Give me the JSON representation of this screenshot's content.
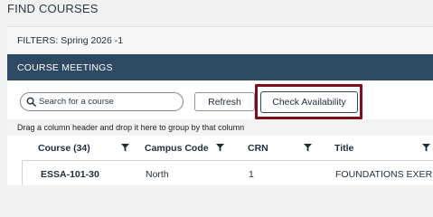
{
  "page": {
    "title": "FIND COURSES"
  },
  "filters": {
    "text": "FILTERS: Spring 2026 -1"
  },
  "section": {
    "title": "COURSE MEETINGS"
  },
  "toolbar": {
    "search_placeholder": "Search for a course",
    "refresh_label": "Refresh",
    "check_availability_label": "Check Availability"
  },
  "grid": {
    "group_hint": "Drag a column header and drop it here to group by that column",
    "columns": [
      {
        "label": "Course (34)",
        "icon": "filter-icon"
      },
      {
        "label": "Campus Code",
        "icon": "filter-icon"
      },
      {
        "label": "CRN",
        "icon": "filter-icon"
      },
      {
        "label": "Title",
        "icon": "filter-icon"
      }
    ],
    "rows": [
      {
        "course": "ESSA-101-30",
        "campus": "North",
        "crn": "1",
        "title": "FOUNDATIONS EXER..."
      }
    ]
  },
  "colors": {
    "header_bg": "#2e4a63",
    "highlight": "#7b0f1a",
    "background": "#f1f1f1"
  }
}
